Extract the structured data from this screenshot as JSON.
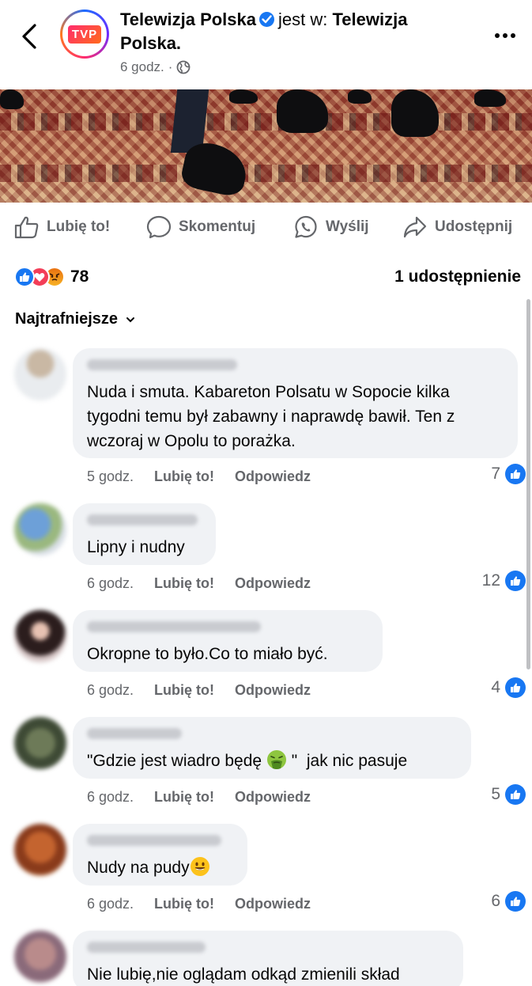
{
  "header": {
    "page_name": "Telewizja Polska",
    "is_at_text": "jest w:",
    "location_name": "Telewizja Polska.",
    "time": "6 godz.",
    "separator": "·",
    "avatar_logo": "TVP"
  },
  "actions": {
    "like": "Lubię to!",
    "comment": "Skomentuj",
    "send": "Wyślij",
    "share": "Udostępnij"
  },
  "reactions": {
    "count": "78",
    "shares": "1 udostępnienie"
  },
  "sort_label": "Najtrafniejsze",
  "comments": [
    {
      "text": "Nuda i smuta. Kabareton Polsatu w Sopocie kilka tygodni temu był zabawny i naprawdę bawił. Ten z wczoraj w Opolu to porażka.",
      "time": "5 godz.",
      "like": "Lubię to!",
      "reply": "Odpowiedz",
      "likes": "7"
    },
    {
      "text": "Lipny i nudny",
      "time": "6 godz.",
      "like": "Lubię to!",
      "reply": "Odpowiedz",
      "likes": "12"
    },
    {
      "text": "Okropne to było.Co to miało być.",
      "time": "6 godz.",
      "like": "Lubię to!",
      "reply": "Odpowiedz",
      "likes": "4"
    },
    {
      "text_before": "\"Gdzie jest wiadro będę ",
      "text_after": " \"  jak nic pasuje",
      "emoji": "nauseated-face",
      "time": "6 godz.",
      "like": "Lubię to!",
      "reply": "Odpowiedz",
      "likes": "5"
    },
    {
      "text": "Nudy na pudy",
      "emoji": "smiling-face",
      "time": "6 godz.",
      "like": "Lubię to!",
      "reply": "Odpowiedz",
      "likes": "6"
    },
    {
      "text": "Nie lubię,nie oglądam odkąd zmienili skład"
    }
  ],
  "colors": {
    "accent": "#1877f2",
    "secondary_text": "#65676b",
    "bubble": "#f0f2f5"
  }
}
